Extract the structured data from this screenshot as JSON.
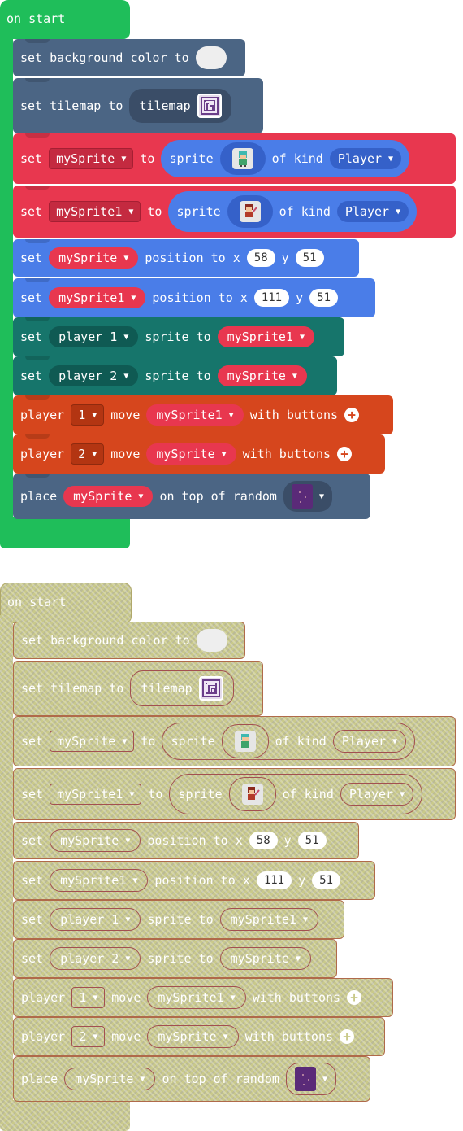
{
  "event": "on start",
  "colors": {
    "event": "#1fbe5a",
    "scene": "#4b6584",
    "sprites": "#e8374f",
    "spritesDark": "#c42a40",
    "position": "#4a7de8",
    "positionDark": "#3561c9",
    "multiplayer": "#16756b",
    "multiplayerDark": "#0f5a53",
    "controller": "#d6461d",
    "controllerDark": "#b33512",
    "tilemapPill": "#3a4d67",
    "kindPill": "#3561c9"
  },
  "blocks": {
    "b1": {
      "text": "set background color to"
    },
    "b2": {
      "pre": "set tilemap to",
      "pill": "tilemap",
      "icon": "tilemap-thumbnail-icon"
    },
    "b3": {
      "set": "set",
      "var": "mySprite",
      "to": "to",
      "sprite": "sprite",
      "kind": "of kind",
      "kindval": "Player"
    },
    "b4": {
      "set": "set",
      "var": "mySprite1",
      "to": "to",
      "sprite": "sprite",
      "kind": "of kind",
      "kindval": "Player"
    },
    "b5": {
      "set": "set",
      "var": "mySprite",
      "pos": "position to x",
      "x": "58",
      "ylabel": "y",
      "y": "51"
    },
    "b6": {
      "set": "set",
      "var": "mySprite1",
      "pos": "position to x",
      "x": "111",
      "ylabel": "y",
      "y": "51"
    },
    "b7": {
      "set": "set",
      "player": "player 1",
      "mid": "sprite to",
      "var": "mySprite1"
    },
    "b8": {
      "set": "set",
      "player": "player 2",
      "mid": "sprite to",
      "var": "mySprite"
    },
    "b9": {
      "pre": "player",
      "num": "1",
      "move": "move",
      "var": "mySprite1",
      "post": "with buttons"
    },
    "b10": {
      "pre": "player",
      "num": "2",
      "move": "move",
      "var": "mySprite",
      "post": "with buttons"
    },
    "b11": {
      "pre": "place",
      "var": "mySprite",
      "post": "on top of random"
    }
  }
}
